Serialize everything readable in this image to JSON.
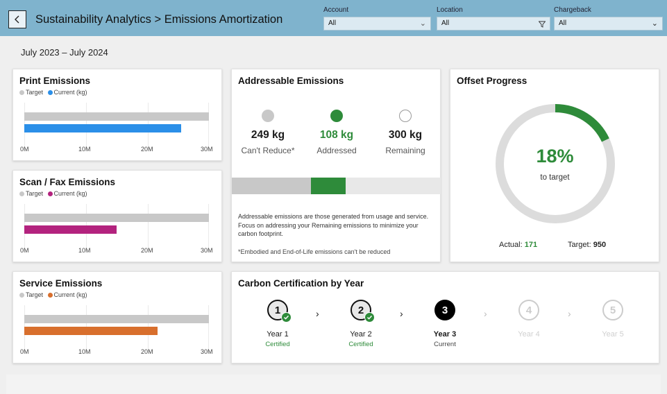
{
  "header": {
    "title": "Sustainability Analytics > Emissions Amortization",
    "filters": [
      {
        "label": "Account",
        "value": "All",
        "icon": "chevron-down-icon"
      },
      {
        "label": "Location",
        "value": "All",
        "icon": "filter-icon"
      },
      {
        "label": "Chargeback",
        "value": "All",
        "icon": "chevron-down-icon"
      }
    ]
  },
  "date_range": "July 2023 – July 2024",
  "emission_cards": [
    {
      "title": "Print Emissions",
      "legend_target": "Target",
      "legend_current": "Current (kg)",
      "target_value": 30,
      "current_value": 25.5,
      "current_color": "#2b8fe8",
      "ticks": [
        "0M",
        "10M",
        "20M",
        "30M"
      ]
    },
    {
      "title": "Scan / Fax Emissions",
      "legend_target": "Target",
      "legend_current": "Current (kg)",
      "target_value": 30,
      "current_value": 15,
      "current_color": "#b3237e",
      "ticks": [
        "0M",
        "10M",
        "20M",
        "30M"
      ]
    },
    {
      "title": "Service Emissions",
      "legend_target": "Target",
      "legend_current": "Current (kg)",
      "target_value": 30,
      "current_value": 21.7,
      "current_color": "#d86f2d",
      "ticks": [
        "0M",
        "10M",
        "20M",
        "30M"
      ]
    }
  ],
  "addressable": {
    "title": "Addressable Emissions",
    "stats": [
      {
        "value": "249 kg",
        "label": "Can't Reduce*",
        "color": "#c8c8c8"
      },
      {
        "value": "108 kg",
        "label": "Addressed",
        "color": "#2e8b3a"
      },
      {
        "value": "300 kg",
        "label": "Remaining",
        "color": "#ffffff"
      }
    ],
    "description": "Addressable emissions are those generated from usage and service. Focus on addressing your Remaining emissions to minimize your carbon footprint.",
    "note": "*Embodied and End-of-Life emissions can't be reduced"
  },
  "offset": {
    "title": "Offset Progress",
    "percent": "18%",
    "percent_value": 18,
    "subtitle": "to target",
    "actual_label": "Actual:",
    "actual_value": "171",
    "target_label": "Target:",
    "target_value": "950"
  },
  "certification": {
    "title": "Carbon Certification by Year",
    "steps": [
      {
        "number": "1",
        "name": "Year 1",
        "status": "Certified",
        "state": "certified"
      },
      {
        "number": "2",
        "name": "Year 2",
        "status": "Certified",
        "state": "certified"
      },
      {
        "number": "3",
        "name": "Year 3",
        "status": "Current",
        "state": "current"
      },
      {
        "number": "4",
        "name": "Year 4",
        "status": "",
        "state": "future"
      },
      {
        "number": "5",
        "name": "Year 5",
        "status": "",
        "state": "future"
      }
    ]
  },
  "colors": {
    "header": "#7fb3cd",
    "accent_green": "#2e8b3a",
    "target_gray": "#c8c8c8"
  }
}
